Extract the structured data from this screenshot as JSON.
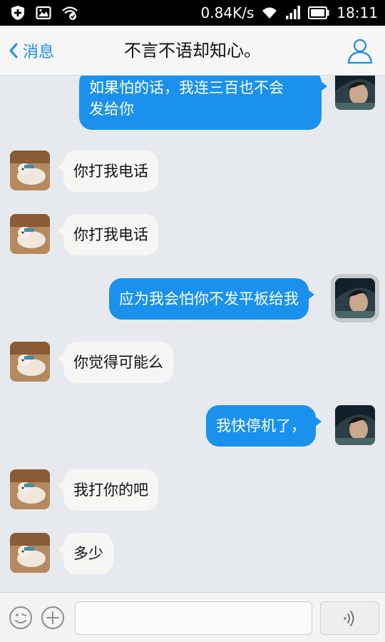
{
  "status_bar": {
    "speed": "0.84K/s",
    "time": "18:11",
    "icons": [
      "shield-icon",
      "image-icon",
      "sync-wifi-icon",
      "wifi-icon",
      "signal-icon",
      "battery-icon"
    ]
  },
  "header": {
    "back_label": "消息",
    "title": "不言不语却知心。",
    "profile_icon": "person-icon"
  },
  "messages": [
    {
      "side": "out",
      "lines": [
        "如果怕的话，我连三百也不会",
        "发给你"
      ]
    },
    {
      "side": "in",
      "lines": [
        "你打我电话"
      ]
    },
    {
      "side": "in",
      "lines": [
        "你打我电话"
      ]
    },
    {
      "side": "out",
      "lines": [
        "应为我会怕你不发平板给我"
      ]
    },
    {
      "side": "in",
      "lines": [
        "你觉得可能么"
      ]
    },
    {
      "side": "out",
      "lines": [
        "我快停机了，"
      ]
    },
    {
      "side": "in",
      "lines": [
        "我打你的吧"
      ]
    },
    {
      "side": "in",
      "lines": [
        "多少"
      ]
    }
  ],
  "input_bar": {
    "emoji_icon": "smiley-icon",
    "plus_icon": "plus-icon",
    "voice_icon": "voice-icon",
    "text_value": ""
  },
  "colors": {
    "accent": "#1a8ce6",
    "out_bubble": "#1a91ec",
    "in_bubble": "#f4f7f3",
    "background": "#e6eaee"
  }
}
